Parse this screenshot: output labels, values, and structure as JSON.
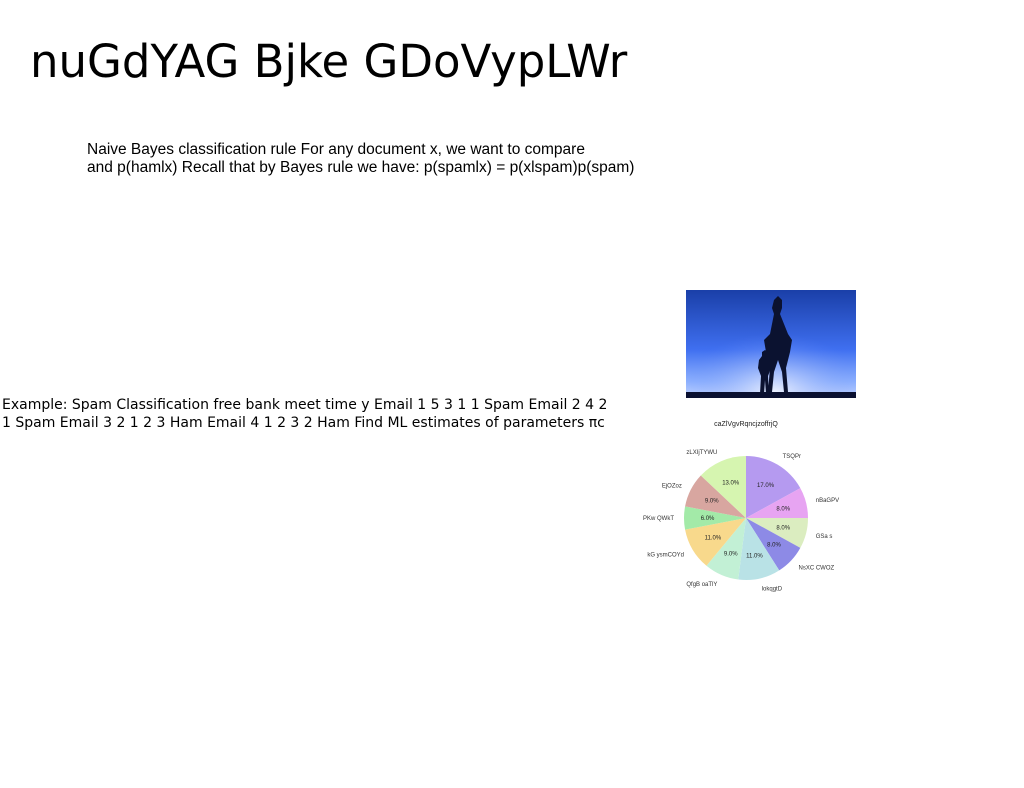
{
  "slide": {
    "title": "nuGdYAG Bjke GDoVypLWr",
    "body_line1": "Naive Bayes classification rule For any document x, we want to compare",
    "body_line2": "and p(hamlx) Recall that by Bayes rule we have: p(spamlx) = p(xlspam)p(spam)",
    "example": "Example: Spam Classification free bank meet time y Email 1 5 3 1 1 Spam Email 2 4 2 1 Spam Email 3 2 1 2 3 Ham Email 4 1 2 3 2 Ham Find ML estimates of parameters πc"
  },
  "chart_data": {
    "type": "pie",
    "start_angle_deg": 90,
    "direction": "clockwise",
    "labels": [
      "caZlVgvRqncjzoffrjQ",
      "TSQPr",
      "nBaGPV",
      "GSa s",
      "NsXC CWOZ",
      "lokqgtD",
      "QfgB oaTlY",
      "kG ysmCOYd",
      "PKw QWkT",
      "EjOZoz",
      "zLXIjTYWU"
    ],
    "values": [
      17.0,
      8.0,
      8.0,
      8.0,
      11.0,
      9.0,
      11.0,
      6.0,
      9.0,
      13.0,
      0
    ],
    "slices": [
      {
        "label": "TSQPr",
        "value": 17.0,
        "pct": "17.0%",
        "color": "#b59af0"
      },
      {
        "label": "nBaGPV",
        "value": 8.0,
        "pct": "8.0%",
        "color": "#e7a4f2"
      },
      {
        "label": "GSa s",
        "value": 8.0,
        "pct": "8.0%",
        "color": "#dbedc0"
      },
      {
        "label": "NsXC CWOZ",
        "value": 8.0,
        "pct": "8.0%",
        "color": "#8d8ae6"
      },
      {
        "label": "lokqgtD",
        "value": 11.0,
        "pct": "11.0%",
        "color": "#b9e2e6"
      },
      {
        "label": "QfgB oaTlY",
        "value": 9.0,
        "pct": "9.0%",
        "color": "#c2f0d5"
      },
      {
        "label": "kG ysmCOYd",
        "value": 11.0,
        "pct": "11.0%",
        "color": "#f8d98c"
      },
      {
        "label": "PKw QWkT",
        "value": 6.0,
        "pct": "6.0%",
        "color": "#a3eaa8"
      },
      {
        "label": "EjOZoz",
        "value": 9.0,
        "pct": "9.0%",
        "color": "#d8a6a0"
      },
      {
        "label": "zLXIjTYWU",
        "value": 13.0,
        "pct": "13.0%",
        "color": "#d6f5b0"
      }
    ],
    "title": "caZlVgvRqncjzoffrjQ"
  }
}
